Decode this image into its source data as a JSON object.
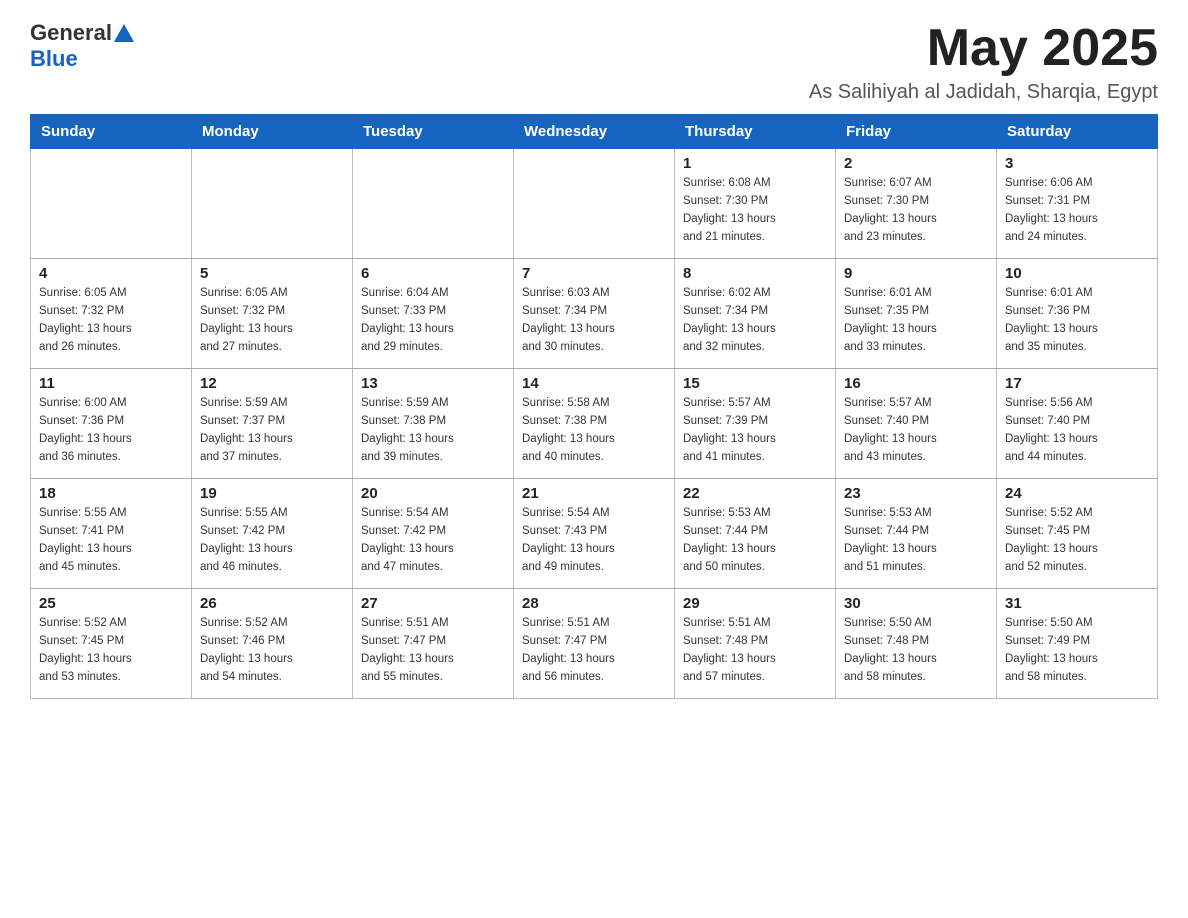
{
  "header": {
    "logo_general": "General",
    "logo_blue": "Blue",
    "month_title": "May 2025",
    "location": "As Salihiyah al Jadidah, Sharqia, Egypt"
  },
  "weekdays": [
    "Sunday",
    "Monday",
    "Tuesday",
    "Wednesday",
    "Thursday",
    "Friday",
    "Saturday"
  ],
  "weeks": [
    [
      {
        "day": "",
        "info": ""
      },
      {
        "day": "",
        "info": ""
      },
      {
        "day": "",
        "info": ""
      },
      {
        "day": "",
        "info": ""
      },
      {
        "day": "1",
        "info": "Sunrise: 6:08 AM\nSunset: 7:30 PM\nDaylight: 13 hours\nand 21 minutes."
      },
      {
        "day": "2",
        "info": "Sunrise: 6:07 AM\nSunset: 7:30 PM\nDaylight: 13 hours\nand 23 minutes."
      },
      {
        "day": "3",
        "info": "Sunrise: 6:06 AM\nSunset: 7:31 PM\nDaylight: 13 hours\nand 24 minutes."
      }
    ],
    [
      {
        "day": "4",
        "info": "Sunrise: 6:05 AM\nSunset: 7:32 PM\nDaylight: 13 hours\nand 26 minutes."
      },
      {
        "day": "5",
        "info": "Sunrise: 6:05 AM\nSunset: 7:32 PM\nDaylight: 13 hours\nand 27 minutes."
      },
      {
        "day": "6",
        "info": "Sunrise: 6:04 AM\nSunset: 7:33 PM\nDaylight: 13 hours\nand 29 minutes."
      },
      {
        "day": "7",
        "info": "Sunrise: 6:03 AM\nSunset: 7:34 PM\nDaylight: 13 hours\nand 30 minutes."
      },
      {
        "day": "8",
        "info": "Sunrise: 6:02 AM\nSunset: 7:34 PM\nDaylight: 13 hours\nand 32 minutes."
      },
      {
        "day": "9",
        "info": "Sunrise: 6:01 AM\nSunset: 7:35 PM\nDaylight: 13 hours\nand 33 minutes."
      },
      {
        "day": "10",
        "info": "Sunrise: 6:01 AM\nSunset: 7:36 PM\nDaylight: 13 hours\nand 35 minutes."
      }
    ],
    [
      {
        "day": "11",
        "info": "Sunrise: 6:00 AM\nSunset: 7:36 PM\nDaylight: 13 hours\nand 36 minutes."
      },
      {
        "day": "12",
        "info": "Sunrise: 5:59 AM\nSunset: 7:37 PM\nDaylight: 13 hours\nand 37 minutes."
      },
      {
        "day": "13",
        "info": "Sunrise: 5:59 AM\nSunset: 7:38 PM\nDaylight: 13 hours\nand 39 minutes."
      },
      {
        "day": "14",
        "info": "Sunrise: 5:58 AM\nSunset: 7:38 PM\nDaylight: 13 hours\nand 40 minutes."
      },
      {
        "day": "15",
        "info": "Sunrise: 5:57 AM\nSunset: 7:39 PM\nDaylight: 13 hours\nand 41 minutes."
      },
      {
        "day": "16",
        "info": "Sunrise: 5:57 AM\nSunset: 7:40 PM\nDaylight: 13 hours\nand 43 minutes."
      },
      {
        "day": "17",
        "info": "Sunrise: 5:56 AM\nSunset: 7:40 PM\nDaylight: 13 hours\nand 44 minutes."
      }
    ],
    [
      {
        "day": "18",
        "info": "Sunrise: 5:55 AM\nSunset: 7:41 PM\nDaylight: 13 hours\nand 45 minutes."
      },
      {
        "day": "19",
        "info": "Sunrise: 5:55 AM\nSunset: 7:42 PM\nDaylight: 13 hours\nand 46 minutes."
      },
      {
        "day": "20",
        "info": "Sunrise: 5:54 AM\nSunset: 7:42 PM\nDaylight: 13 hours\nand 47 minutes."
      },
      {
        "day": "21",
        "info": "Sunrise: 5:54 AM\nSunset: 7:43 PM\nDaylight: 13 hours\nand 49 minutes."
      },
      {
        "day": "22",
        "info": "Sunrise: 5:53 AM\nSunset: 7:44 PM\nDaylight: 13 hours\nand 50 minutes."
      },
      {
        "day": "23",
        "info": "Sunrise: 5:53 AM\nSunset: 7:44 PM\nDaylight: 13 hours\nand 51 minutes."
      },
      {
        "day": "24",
        "info": "Sunrise: 5:52 AM\nSunset: 7:45 PM\nDaylight: 13 hours\nand 52 minutes."
      }
    ],
    [
      {
        "day": "25",
        "info": "Sunrise: 5:52 AM\nSunset: 7:45 PM\nDaylight: 13 hours\nand 53 minutes."
      },
      {
        "day": "26",
        "info": "Sunrise: 5:52 AM\nSunset: 7:46 PM\nDaylight: 13 hours\nand 54 minutes."
      },
      {
        "day": "27",
        "info": "Sunrise: 5:51 AM\nSunset: 7:47 PM\nDaylight: 13 hours\nand 55 minutes."
      },
      {
        "day": "28",
        "info": "Sunrise: 5:51 AM\nSunset: 7:47 PM\nDaylight: 13 hours\nand 56 minutes."
      },
      {
        "day": "29",
        "info": "Sunrise: 5:51 AM\nSunset: 7:48 PM\nDaylight: 13 hours\nand 57 minutes."
      },
      {
        "day": "30",
        "info": "Sunrise: 5:50 AM\nSunset: 7:48 PM\nDaylight: 13 hours\nand 58 minutes."
      },
      {
        "day": "31",
        "info": "Sunrise: 5:50 AM\nSunset: 7:49 PM\nDaylight: 13 hours\nand 58 minutes."
      }
    ]
  ]
}
